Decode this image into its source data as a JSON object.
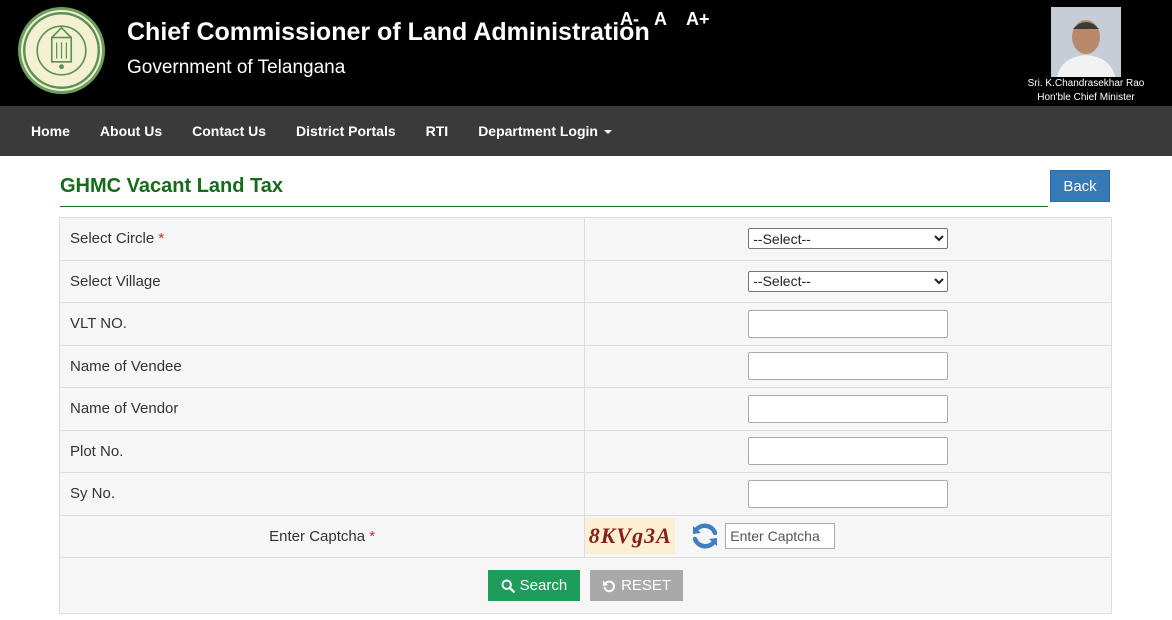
{
  "header": {
    "title": "Chief Commissioner of Land Administration",
    "subtitle": "Government of Telangana",
    "font_controls": {
      "decrease": "A-",
      "normal": "A",
      "increase": "A+"
    },
    "cm_name": "Sri. K.Chandrasekhar Rao",
    "cm_title": "Hon'ble Chief Minister",
    "logo_icon": "telangana-emblem-icon",
    "photo_icon": "chief-minister-photo"
  },
  "nav": {
    "items": [
      "Home",
      "About Us",
      "Contact Us",
      "District Portals",
      "RTI",
      "Department Login"
    ]
  },
  "page": {
    "title": "GHMC Vacant Land Tax",
    "back_label": "Back"
  },
  "form": {
    "circle": {
      "label": "Select Circle",
      "required": "*",
      "selected": "--Select--"
    },
    "village": {
      "label": "Select Village",
      "selected": "--Select--"
    },
    "vlt": {
      "label": "VLT NO.",
      "value": ""
    },
    "vendee": {
      "label": "Name of Vendee",
      "value": ""
    },
    "vendor": {
      "label": "Name of Vendor",
      "value": ""
    },
    "plot": {
      "label": "Plot No.",
      "value": ""
    },
    "sy": {
      "label": "Sy No.",
      "value": ""
    },
    "captcha": {
      "label": "Enter Captcha",
      "required": "*",
      "code": "8KVg3A",
      "placeholder": "Enter Captcha",
      "value": ""
    },
    "search_label": "Search",
    "reset_label": "RESET"
  },
  "colors": {
    "header_bg": "#000000",
    "nav_bg": "#3a3a3a",
    "title_green": "#146b1a",
    "back_blue": "#337ab7",
    "search_green": "#1f9b5c",
    "reset_gray": "#a9a9a9",
    "required_red": "#c9302c"
  }
}
